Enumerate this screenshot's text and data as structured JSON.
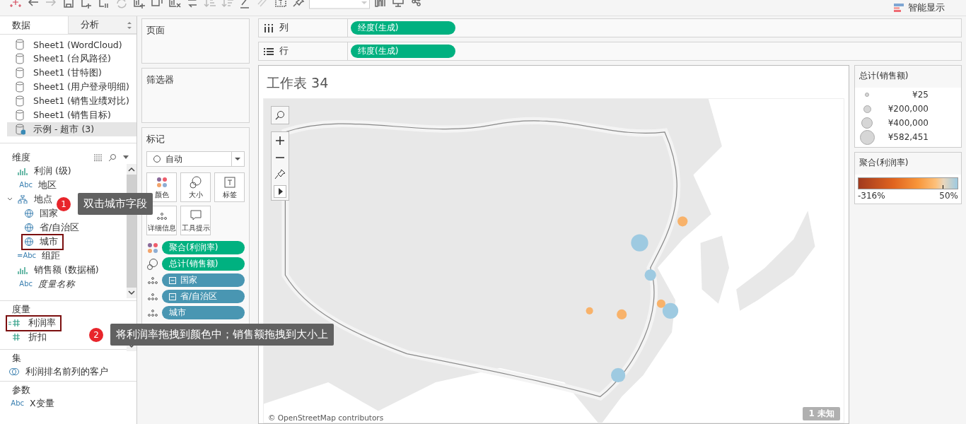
{
  "toolbar": {
    "smart_show": "智能显示"
  },
  "data_tabs": [
    {
      "label": "数据",
      "selected": true
    },
    {
      "label": "分析",
      "selected": false
    }
  ],
  "data_sources": [
    {
      "name": "Sheet1 (WordCloud)",
      "selected": false
    },
    {
      "name": "Sheet1 (台风路径)",
      "selected": false
    },
    {
      "name": "Sheet1 (甘特图)",
      "selected": false
    },
    {
      "name": "Sheet1 (用户登录明细)",
      "selected": false
    },
    {
      "name": "Sheet1 (销售业绩对比)",
      "selected": false
    },
    {
      "name": "Sheet1 (销售目标)",
      "selected": false
    },
    {
      "name": "示例 - 超市 (3)",
      "selected": true
    }
  ],
  "dimensions": {
    "title": "维度",
    "fields": [
      {
        "kind": "bin",
        "label": "利润 (级)",
        "italic": false,
        "highlighted": false
      },
      {
        "kind": "text",
        "icon": "Abc",
        "label": "地区",
        "italic": false,
        "highlighted": false
      },
      {
        "kind": "hierarchy",
        "label": "地点",
        "expanded": true,
        "italic": false,
        "highlighted": false,
        "children": [
          {
            "kind": "geo",
            "label": "国家",
            "highlighted": false
          },
          {
            "kind": "geo",
            "label": "省/自治区",
            "highlighted": false
          },
          {
            "kind": "geo",
            "label": "城市",
            "highlighted": true
          }
        ]
      },
      {
        "kind": "text",
        "icon": "=Abc",
        "label": "组距",
        "italic": false,
        "highlighted": false
      },
      {
        "kind": "bin",
        "label": "销售额 (数据桶)",
        "italic": false,
        "highlighted": false
      },
      {
        "kind": "text",
        "icon": "Abc",
        "label": "度量名称",
        "italic": true,
        "highlighted": false
      }
    ]
  },
  "measures": {
    "title": "度量",
    "fields": [
      {
        "kind": "calc-number",
        "label": "利润率",
        "highlighted": true
      },
      {
        "kind": "number",
        "label": "折扣",
        "highlighted": false
      }
    ]
  },
  "sets": {
    "title": "集",
    "items": [
      "利润排名前列的客户"
    ]
  },
  "parameters": {
    "title": "参数",
    "fields": [
      {
        "kind": "text",
        "icon": "Abc",
        "label": "X变量"
      }
    ]
  },
  "pages_shelf": {
    "title": "页面"
  },
  "filters_shelf": {
    "title": "筛选器"
  },
  "marks": {
    "title": "标记",
    "mark_type": "自动",
    "buttons": [
      {
        "kind": "color",
        "label": "颜色"
      },
      {
        "kind": "size",
        "label": "大小"
      },
      {
        "kind": "label",
        "label": "标签"
      },
      {
        "kind": "detail",
        "label": "详细信息"
      },
      {
        "kind": "tooltip",
        "label": "工具提示"
      }
    ],
    "pills": [
      {
        "kind": "color",
        "measure": true,
        "label": "聚合(利润率)",
        "collapsible": false
      },
      {
        "kind": "size",
        "measure": true,
        "label": "总计(销售额)",
        "collapsible": false
      },
      {
        "kind": "detail",
        "measure": false,
        "label": "国家",
        "collapsible": true
      },
      {
        "kind": "detail",
        "measure": false,
        "label": "省/自治区",
        "collapsible": true
      },
      {
        "kind": "detail",
        "measure": false,
        "label": "城市",
        "collapsible": false
      }
    ]
  },
  "columns_shelf": {
    "label": "列",
    "pill": "经度(生成)"
  },
  "rows_shelf": {
    "label": "行",
    "pill": "纬度(生成)"
  },
  "sheet": {
    "title": "工作表 34",
    "attribution": "© OpenStreetMap contributors",
    "unknown_badge": "1 未知"
  },
  "legends": {
    "size": {
      "title": "总计(销售额)",
      "items": [
        "¥25",
        "¥200,000",
        "¥400,000",
        "¥582,451"
      ]
    },
    "color": {
      "title": "聚合(利润率)",
      "min": "-316%",
      "max": "50%"
    }
  },
  "callouts": [
    {
      "number": "1",
      "text": "双击城市字段"
    },
    {
      "number": "2",
      "text": "将利润率拖拽到颜色中；销售额拖拽到大小上"
    }
  ]
}
